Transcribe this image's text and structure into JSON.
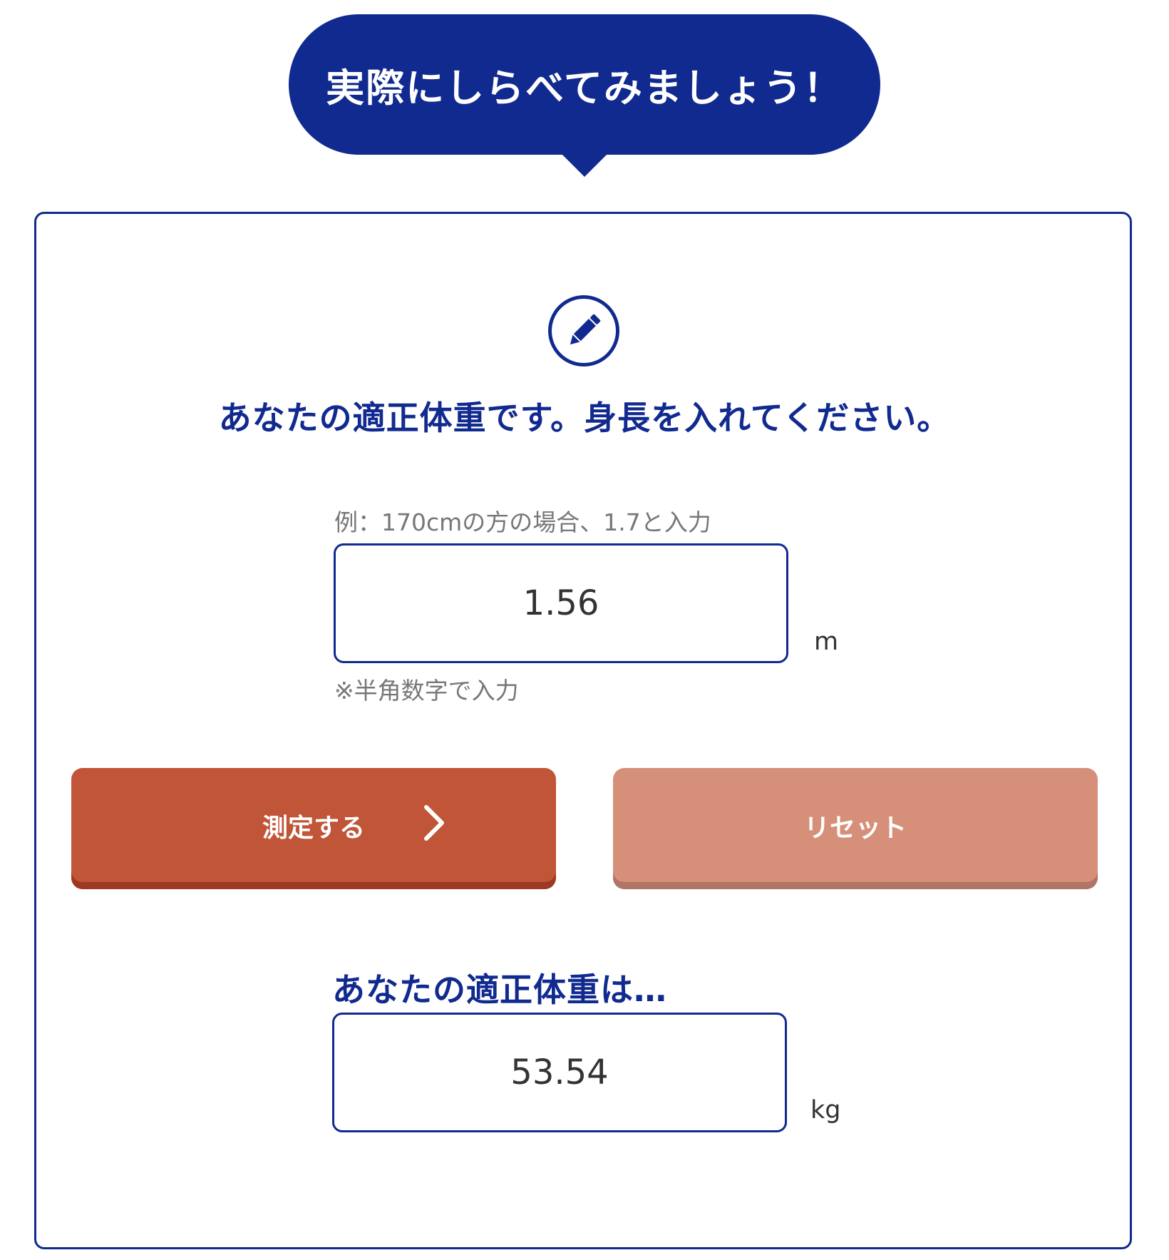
{
  "colors": {
    "primary_navy": "#112a8f",
    "measure_button": "#c05537",
    "reset_button": "#d6907a"
  },
  "bubble": {
    "title": "実際にしらべてみましょう！"
  },
  "form": {
    "icon": "pencil-icon",
    "heading": "あなたの適正体重です。身長を入れてください。",
    "example_hint": "例：170cmの方の場合、1.7と入力",
    "height_value": "1.56",
    "height_unit": "m",
    "halfwidth_note": "※半角数字で入力"
  },
  "buttons": {
    "measure_label": "測定する",
    "measure_icon": "chevron-right-icon",
    "reset_label": "リセット"
  },
  "result": {
    "heading": "あなたの適正体重は…",
    "weight_value": "53.54",
    "weight_unit": "kg"
  }
}
